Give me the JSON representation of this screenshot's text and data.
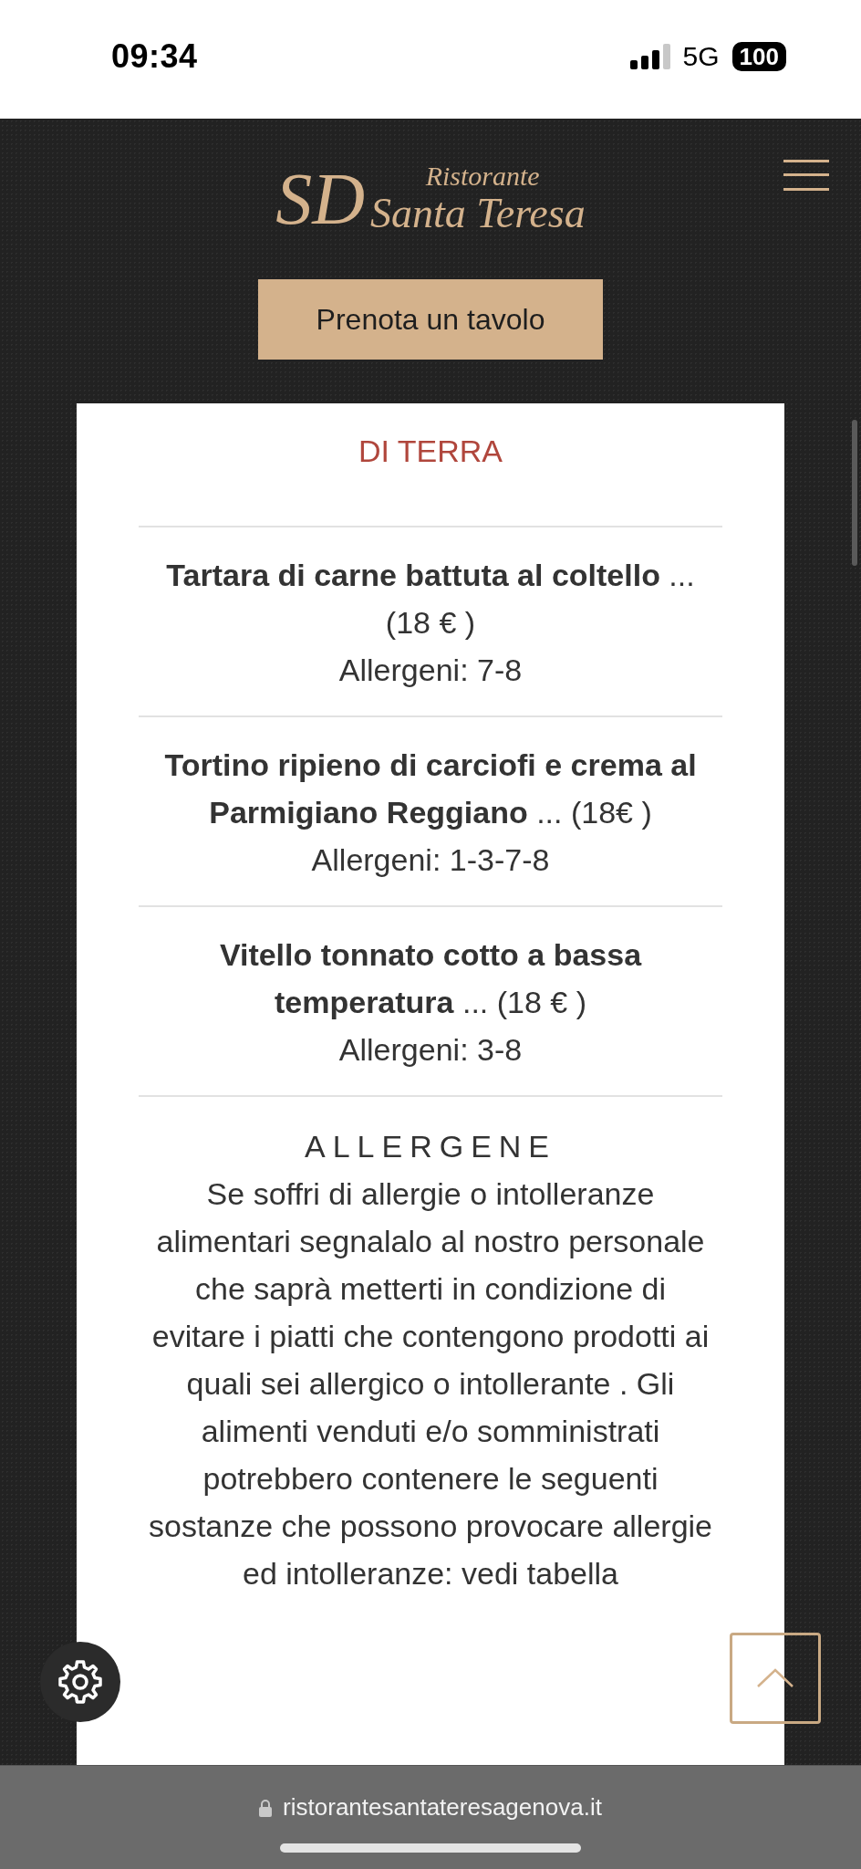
{
  "status_bar": {
    "time": "09:34",
    "network": "5G",
    "battery": "100"
  },
  "header": {
    "logo": {
      "monogram": "SD",
      "line_1": "Ristorante",
      "line_2": "Santa Teresa"
    },
    "book_button": "Prenota un tavolo"
  },
  "menu_card": {
    "section_title": "DI TERRA",
    "dishes": [
      {
        "name": "**Tartara di carne battuta al coltello** ... (18 € )",
        "allergens": "Allergeni: 7-8"
      },
      {
        "name": "**Tortino ripieno di carciofi e crema al Parmigiano Reggiano** ... (18€ )",
        "allergens": "Allergeni: 1-3-7-8"
      },
      {
        "name": "**Vitello tonnato cotto a bassa temperatura** ... (18 € )",
        "allergens": "Allergeni: 3-8"
      }
    ],
    "allergen_notice": {
      "title": "ALLERGENE",
      "text": "Se soffri di allergie o intolleranze alimentari segnalalo al nostro personale che saprà metterti in condizione di evitare i piatti che contengono prodotti ai quali sei allergico o intollerante . Gli alimenti venduti e/o somministrati potrebbero contenere le seguenti sostanze che possono provocare allergie ed intolleranze: vedi tabella"
    }
  },
  "browser_bar": {
    "url": "ristorantesantateresagenova.it"
  }
}
